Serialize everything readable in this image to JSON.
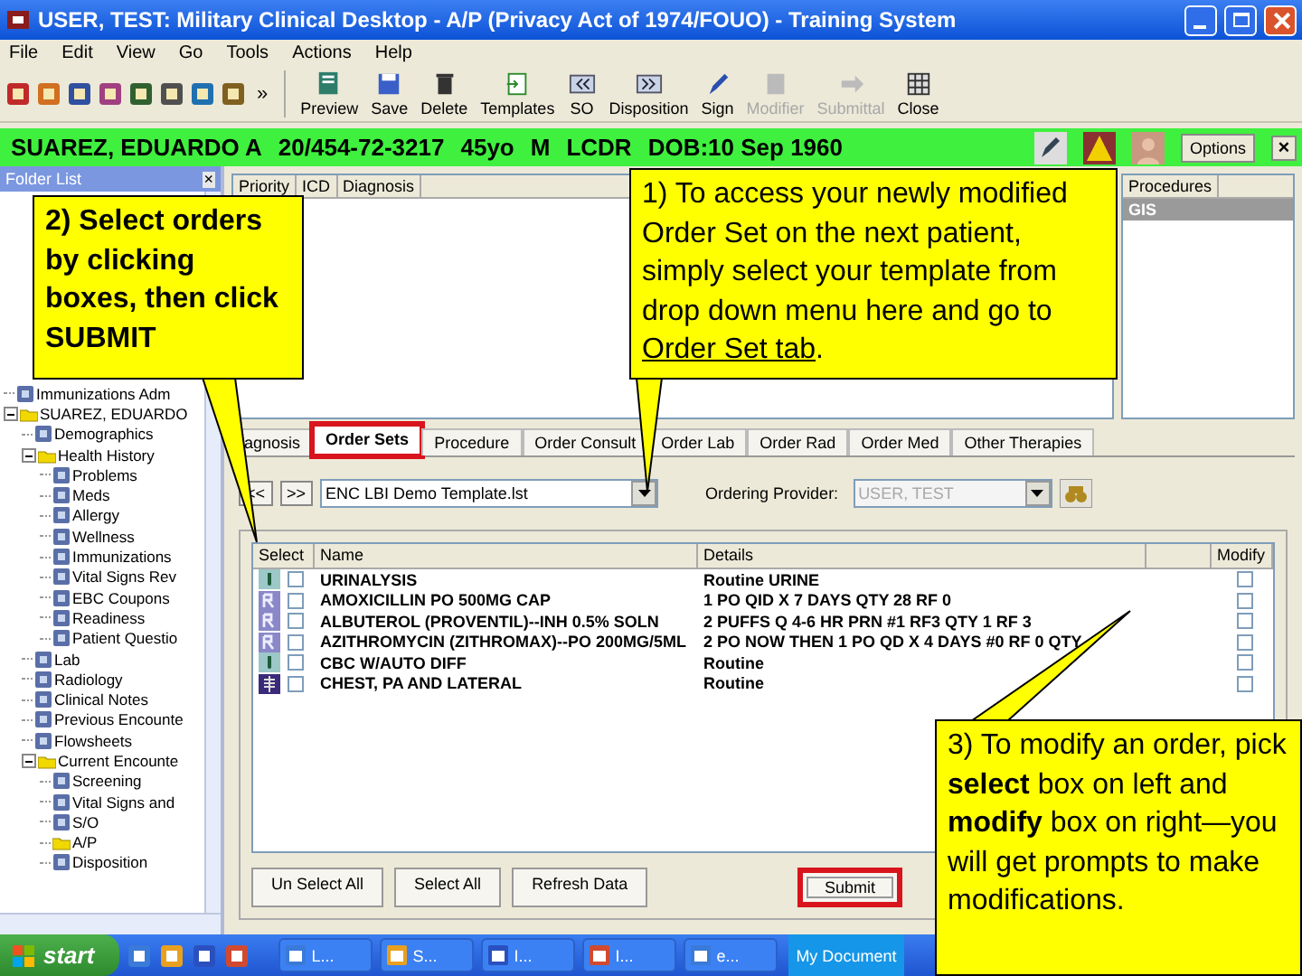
{
  "window": {
    "title": "USER, TEST: Military Clinical Desktop - A/P (Privacy Act of 1974/FOUO) - Training System"
  },
  "menu": [
    "File",
    "Edit",
    "View",
    "Go",
    "Tools",
    "Actions",
    "Help"
  ],
  "toolbar": {
    "overflow": "»",
    "buttons": [
      {
        "label": "Preview",
        "disabled": false
      },
      {
        "label": "Save",
        "disabled": false
      },
      {
        "label": "Delete",
        "disabled": false
      },
      {
        "label": "Templates",
        "disabled": false
      },
      {
        "label": "SO",
        "disabled": false
      },
      {
        "label": "Disposition",
        "disabled": false
      },
      {
        "label": "Sign",
        "disabled": false
      },
      {
        "label": "Modifier",
        "disabled": true
      },
      {
        "label": "Submittal",
        "disabled": true
      },
      {
        "label": "Close",
        "disabled": false
      }
    ]
  },
  "patient": {
    "name": "SUAREZ, EDUARDO A",
    "id": "20/454-72-3217",
    "age": "45yo",
    "sex": "M",
    "rank": "LCDR",
    "dob": "DOB:10 Sep 1960",
    "options": "Options",
    "close": "×"
  },
  "folder_list": {
    "title": "Folder List",
    "close": "×",
    "items": [
      {
        "label": "Immunizations Adm",
        "kind": "module"
      },
      {
        "label": "SUAREZ, EDUARDO",
        "kind": "folder",
        "expanded": true,
        "children": [
          {
            "label": "Demographics",
            "kind": "module"
          },
          {
            "label": "Health History",
            "kind": "folder",
            "expanded": true,
            "children": [
              {
                "label": "Problems",
                "kind": "module"
              },
              {
                "label": "Meds",
                "kind": "module"
              },
              {
                "label": "Allergy",
                "kind": "module"
              },
              {
                "label": "Wellness",
                "kind": "module"
              },
              {
                "label": "Immunizations",
                "kind": "module"
              },
              {
                "label": "Vital Signs Rev",
                "kind": "module"
              },
              {
                "label": "EBC Coupons",
                "kind": "module"
              },
              {
                "label": "Readiness",
                "kind": "module"
              },
              {
                "label": "Patient Questio",
                "kind": "module"
              }
            ]
          },
          {
            "label": "Lab",
            "kind": "module"
          },
          {
            "label": "Radiology",
            "kind": "module"
          },
          {
            "label": "Clinical Notes",
            "kind": "module"
          },
          {
            "label": "Previous Encounte",
            "kind": "module"
          },
          {
            "label": "Flowsheets",
            "kind": "module"
          },
          {
            "label": "Current Encounte",
            "kind": "folder",
            "expanded": true,
            "children": [
              {
                "label": "Screening",
                "kind": "module"
              },
              {
                "label": "Vital Signs and",
                "kind": "module"
              },
              {
                "label": "S/O",
                "kind": "module"
              },
              {
                "label": "A/P",
                "kind": "folder"
              },
              {
                "label": "Disposition",
                "kind": "module"
              }
            ]
          }
        ]
      }
    ]
  },
  "diagnosis_table": {
    "columns": [
      "Priority",
      "ICD",
      "Diagnosis"
    ]
  },
  "procedures": {
    "column": "Procedures",
    "rows": [
      {
        "text": "GIS",
        "selected": true
      }
    ]
  },
  "tabs": [
    {
      "label": "agnosis",
      "selected": false,
      "highlighted": false
    },
    {
      "label": "Order Sets",
      "selected": true,
      "highlighted": true
    },
    {
      "label": "Procedure",
      "selected": false,
      "highlighted": false
    },
    {
      "label": "Order Consult",
      "selected": false,
      "highlighted": false
    },
    {
      "label": "Order Lab",
      "selected": false,
      "highlighted": false
    },
    {
      "label": "Order Rad",
      "selected": false,
      "highlighted": false
    },
    {
      "label": "Order Med",
      "selected": false,
      "highlighted": false
    },
    {
      "label": "Other Therapies",
      "selected": false,
      "highlighted": false
    }
  ],
  "order_set": {
    "prev": "<<",
    "next": ">>",
    "template": "ENC LBI Demo Template.lst",
    "provider_label": "Ordering Provider:",
    "provider": "USER, TEST",
    "provider_disabled": true
  },
  "orders": {
    "columns": [
      "Select",
      "Name",
      "Details",
      "Modify"
    ],
    "rows": [
      {
        "kind": "lab",
        "name": "URINALYSIS",
        "details": "Routine URINE",
        "selected": false,
        "modify": false
      },
      {
        "kind": "rx",
        "name": "AMOXICILLIN PO 500MG CAP",
        "details": "1 PO QID X 7 DAYS QTY 28 RF 0",
        "selected": false,
        "modify": false
      },
      {
        "kind": "rx",
        "name": "ALBUTEROL (PROVENTIL)--INH 0.5% SOLN",
        "details": "2 PUFFS Q 4-6 HR PRN #1 RF3 QTY 1 RF 3",
        "selected": false,
        "modify": false
      },
      {
        "kind": "rx",
        "name": "AZITHROMYCIN (ZITHROMAX)--PO 200MG/5ML",
        "details": "2 PO NOW THEN 1 PO QD X 4 DAYS #0 RF 0 QTY",
        "selected": false,
        "modify": false
      },
      {
        "kind": "lab",
        "name": "CBC W/AUTO DIFF",
        "details": "Routine",
        "selected": false,
        "modify": false
      },
      {
        "kind": "rad",
        "name": "CHEST, PA AND LATERAL",
        "details": "Routine",
        "selected": false,
        "modify": false
      }
    ]
  },
  "buttons": [
    {
      "label": "Un Select All",
      "highlighted": false
    },
    {
      "label": "Select All",
      "highlighted": false
    },
    {
      "label": "Refresh Data",
      "highlighted": false
    },
    {
      "label": "Submit",
      "highlighted": true
    }
  ],
  "callouts": [
    {
      "text": "2) Select orders by clicking boxes, then click SUBMIT"
    },
    {
      "text": "1) To access your newly modified Order Set on the next patient, simply select your template from drop down menu here and go to",
      "link": "Order Set tab",
      "end": "."
    },
    {
      "text": "3) To modify an order, pick **select** box on left and **modify** box on right—you will get prompts to make modifications."
    }
  ],
  "taskbar": {
    "start": "start",
    "tasks": [
      "L...",
      "S...",
      "I...",
      "I...",
      "e..."
    ],
    "tray": "My Document"
  }
}
